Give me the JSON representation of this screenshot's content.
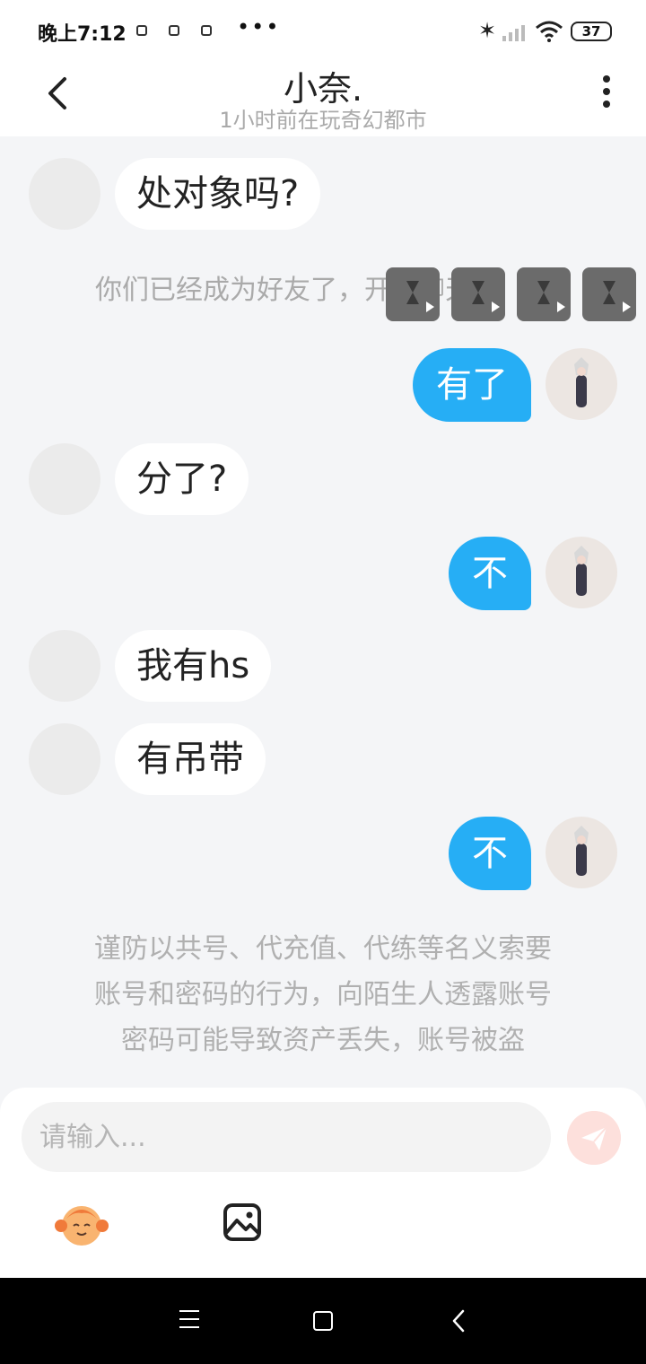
{
  "status_bar": {
    "time": "晚上7:12",
    "dots": "•••",
    "battery": "37",
    "icons": [
      "notification-icon",
      "bluetooth-icon",
      "signal-icon",
      "wifi-icon",
      "battery-icon"
    ]
  },
  "header": {
    "title": "小奈.",
    "subtitle": "1小时前在玩奇幻都市",
    "icons": [
      "back-arrow-icon",
      "more-vertical-icon"
    ]
  },
  "messages": [
    {
      "side": "left",
      "text": "处对象吗?"
    },
    {
      "side": "right",
      "text": "有了"
    },
    {
      "side": "left",
      "text": "分了?"
    },
    {
      "side": "right",
      "text": "不"
    },
    {
      "side": "left",
      "text": "我有hs"
    },
    {
      "side": "left",
      "text": "有吊带"
    },
    {
      "side": "right",
      "text": "不"
    }
  ],
  "system_message": "你们已经成为好友了，开始聊天吧",
  "warning": [
    "谨防以共号、代充值、代练等名义索要",
    "账号和密码的行为，向陌生人透露账号",
    "密码可能导致资产丢失，账号被盗"
  ],
  "input": {
    "placeholder": "请输入..."
  },
  "colors": {
    "my_bubble": "#26aef5",
    "their_bubble": "#ffffff",
    "chat_background": "#f4f5f7",
    "send_button": "#fde0dc"
  }
}
